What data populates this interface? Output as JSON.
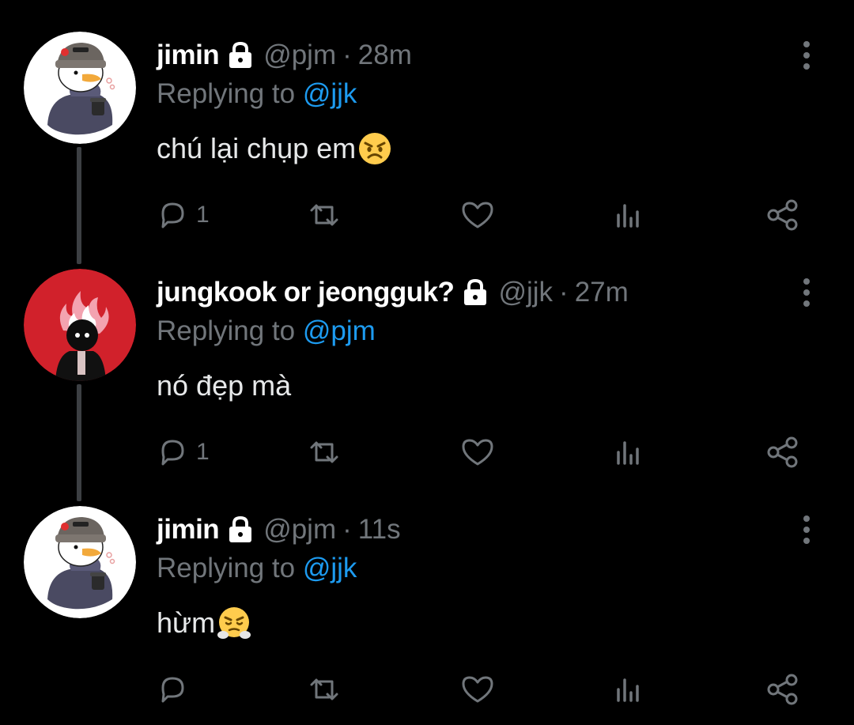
{
  "tweets": [
    {
      "display_name": "jimin",
      "handle": "@pjm",
      "separator": "·",
      "time": "28m",
      "replying_prefix": "Replying to ",
      "replying_to": "@jjk",
      "text": "chú lại chụp em",
      "emoji": "angry-face-emoji",
      "reply_count": "1",
      "avatar": "white-duck-avatar",
      "protected": true
    },
    {
      "display_name": "jungkook or jeongguk?",
      "handle": "@jjk",
      "separator": "·",
      "time": "27m",
      "replying_prefix": "Replying to ",
      "replying_to": "@pjm",
      "text": "nó đẹp mà",
      "emoji": "",
      "reply_count": "1",
      "avatar": "red-flame-avatar",
      "protected": true
    },
    {
      "display_name": "jimin",
      "handle": "@pjm",
      "separator": "·",
      "time": "11s",
      "replying_prefix": "Replying to ",
      "replying_to": "@jjk",
      "text": "hừm",
      "emoji": "face-with-steam-from-nose-emoji",
      "reply_count": "",
      "avatar": "white-duck-avatar",
      "protected": true
    }
  ],
  "colors": {
    "background": "#000000",
    "text_primary": "#e7e9ea",
    "text_secondary": "#71767b",
    "accent": "#1d9bf0",
    "thread_line": "#3c3f43"
  }
}
